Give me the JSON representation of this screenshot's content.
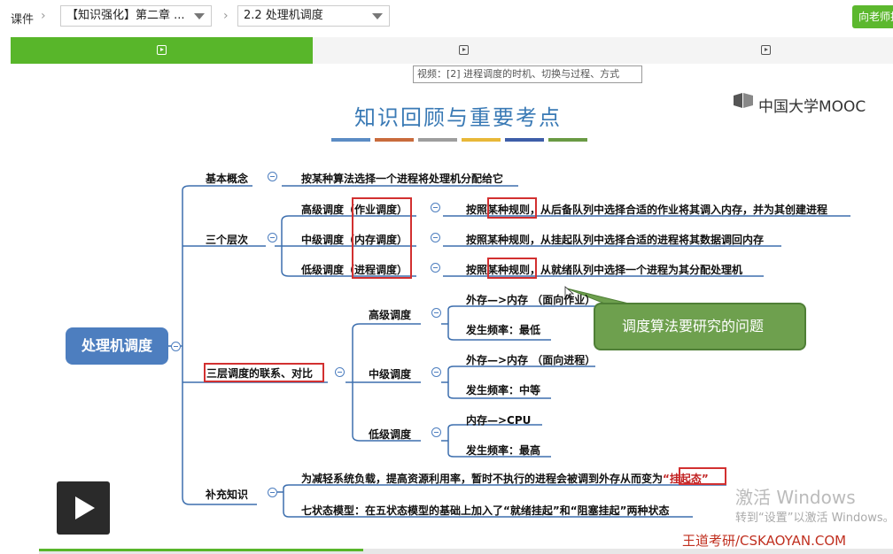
{
  "breadcrumb": {
    "root": "课件",
    "chapter": "【知识强化】第二章 ...",
    "lesson": "2.2 处理机调度",
    "right_button": "向老师提问"
  },
  "tooltip": "视频：[2] 进程调度的时机、切换与过程、方式",
  "slide": {
    "title": "知识回顾与重要考点",
    "logo": "中国大学MOOC",
    "title_colors": [
      "#5b8cc4",
      "#c96b3c",
      "#9e9e9e",
      "#e8b838",
      "#3e5ea8",
      "#6a9a44"
    ],
    "root": "处理机调度",
    "basic": {
      "label": "基本概念",
      "desc": "按某种算法选择一个进程将处理机分配给它"
    },
    "levels": {
      "label": "三个层次",
      "items": [
        {
          "name": "高级调度（作业调度）",
          "desc_pre": "按照",
          "desc_key": "某种规则",
          "desc_post": "，从后备队列中选择合适的作业将其调入内存，并为其创建进程"
        },
        {
          "name": "中级调度（内存调度）",
          "desc_pre": "",
          "desc_key": "",
          "desc_post": "按照某种规则，从挂起队列中选择合适的进程将其数据调回内存"
        },
        {
          "name": "低级调度（进程调度）",
          "desc_pre": "按照",
          "desc_key": "某种规则",
          "desc_post": "，从就绪队列中选择一个进程为其分配处理机"
        }
      ]
    },
    "compare": {
      "label": "三层调度的联系、对比",
      "items": [
        {
          "name": "高级调度",
          "a": "外存—>内存 （面向作业）",
          "b": "发生频率：最低"
        },
        {
          "name": "中级调度",
          "a": "外存—>内存 （面向进程）",
          "b": "发生频率：中等"
        },
        {
          "name": "低级调度",
          "a": "内存—>CPU",
          "b": "发生频率：最高"
        }
      ]
    },
    "extra": {
      "label": "补充知识",
      "line1": "为减轻系统负载，提高资源利用率，暂时不执行的进程会被调到外存从而变为",
      "line1_key": "“挂起态”",
      "line2": "七状态模型：在五状态模型的基础上加入了“就绪挂起”和“阻塞挂起”两种状态"
    },
    "callout": "调度算法要研究的问题"
  },
  "overlay": {
    "activation_title": "激活 Windows",
    "activation_sub": "转到“设置”以激活 Windows。",
    "watermark": "王道考研/CSKAOYAN.COM"
  },
  "video": {
    "progress_percent": 38
  }
}
